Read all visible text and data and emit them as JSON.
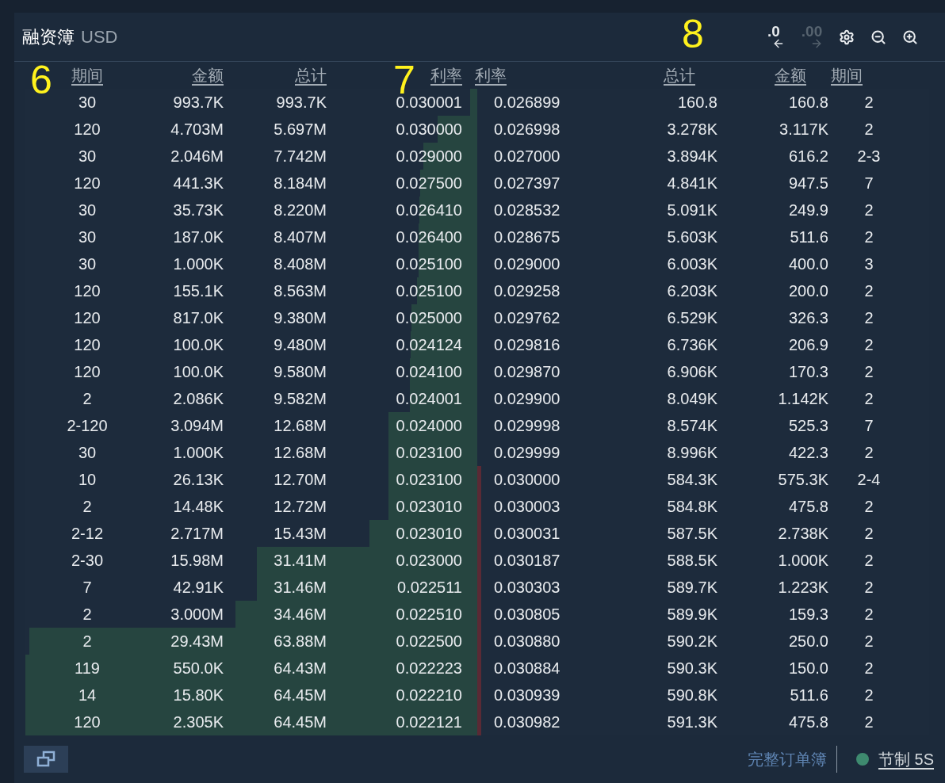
{
  "title": {
    "text": "融资簿",
    "currency": "USD"
  },
  "toolbar": [
    {
      "kind": "precision_down",
      "label": ".0",
      "disabled": false
    },
    {
      "kind": "precision_up",
      "label": ".00",
      "disabled": true
    },
    {
      "kind": "settings"
    },
    {
      "kind": "zoom_out"
    },
    {
      "kind": "zoom_in"
    }
  ],
  "annotations": [
    {
      "label": "6"
    },
    {
      "label": "7"
    },
    {
      "label": "8"
    }
  ],
  "bid_columns": [
    "期间",
    "金额",
    "总计",
    "利率"
  ],
  "ask_columns": [
    "利率",
    "总计",
    "金额",
    "期间"
  ],
  "bids": [
    {
      "period": "30",
      "amount": "993.7K",
      "total": "993.7K",
      "rate": "0.030001",
      "level": 0.015
    },
    {
      "period": "120",
      "amount": "4.703M",
      "total": "5.697M",
      "rate": "0.030000",
      "level": 0.088
    },
    {
      "period": "30",
      "amount": "2.046M",
      "total": "7.742M",
      "rate": "0.029000",
      "level": 0.12
    },
    {
      "period": "120",
      "amount": "441.3K",
      "total": "8.184M",
      "rate": "0.027500",
      "level": 0.127
    },
    {
      "period": "30",
      "amount": "35.73K",
      "total": "8.220M",
      "rate": "0.026410",
      "level": 0.128
    },
    {
      "period": "30",
      "amount": "187.0K",
      "total": "8.407M",
      "rate": "0.026400",
      "level": 0.13
    },
    {
      "period": "30",
      "amount": "1.000K",
      "total": "8.408M",
      "rate": "0.025100",
      "level": 0.13
    },
    {
      "period": "120",
      "amount": "155.1K",
      "total": "8.563M",
      "rate": "0.025100",
      "level": 0.133
    },
    {
      "period": "120",
      "amount": "817.0K",
      "total": "9.380M",
      "rate": "0.025000",
      "level": 0.146
    },
    {
      "period": "120",
      "amount": "100.0K",
      "total": "9.480M",
      "rate": "0.024124",
      "level": 0.147
    },
    {
      "period": "120",
      "amount": "100.0K",
      "total": "9.580M",
      "rate": "0.024100",
      "level": 0.149
    },
    {
      "period": "2",
      "amount": "2.086K",
      "total": "9.582M",
      "rate": "0.024001",
      "level": 0.149
    },
    {
      "period": "2-120",
      "amount": "3.094M",
      "total": "12.68M",
      "rate": "0.024000",
      "level": 0.197
    },
    {
      "period": "30",
      "amount": "1.000K",
      "total": "12.68M",
      "rate": "0.023100",
      "level": 0.197
    },
    {
      "period": "10",
      "amount": "26.13K",
      "total": "12.70M",
      "rate": "0.023100",
      "level": 0.197
    },
    {
      "period": "2",
      "amount": "14.48K",
      "total": "12.72M",
      "rate": "0.023010",
      "level": 0.197
    },
    {
      "period": "2-12",
      "amount": "2.717M",
      "total": "15.43M",
      "rate": "0.023010",
      "level": 0.239
    },
    {
      "period": "2-30",
      "amount": "15.98M",
      "total": "31.41M",
      "rate": "0.023000",
      "level": 0.487
    },
    {
      "period": "7",
      "amount": "42.91K",
      "total": "31.46M",
      "rate": "0.022511",
      "level": 0.488
    },
    {
      "period": "2",
      "amount": "3.000M",
      "total": "34.46M",
      "rate": "0.022510",
      "level": 0.535
    },
    {
      "period": "2",
      "amount": "29.43M",
      "total": "63.88M",
      "rate": "0.022500",
      "level": 0.991
    },
    {
      "period": "119",
      "amount": "550.0K",
      "total": "64.43M",
      "rate": "0.022223",
      "level": 1.0
    },
    {
      "period": "14",
      "amount": "15.80K",
      "total": "64.45M",
      "rate": "0.022210",
      "level": 1.0
    },
    {
      "period": "120",
      "amount": "2.305K",
      "total": "64.45M",
      "rate": "0.022121",
      "level": 1.0
    }
  ],
  "asks": [
    {
      "rate": "0.026899",
      "total": "160.8",
      "amount": "160.8",
      "period": "2"
    },
    {
      "rate": "0.026998",
      "total": "3.278K",
      "amount": "3.117K",
      "period": "2"
    },
    {
      "rate": "0.027000",
      "total": "3.894K",
      "amount": "616.2",
      "period": "2-3"
    },
    {
      "rate": "0.027397",
      "total": "4.841K",
      "amount": "947.5",
      "period": "7"
    },
    {
      "rate": "0.028532",
      "total": "5.091K",
      "amount": "249.9",
      "period": "2"
    },
    {
      "rate": "0.028675",
      "total": "5.603K",
      "amount": "511.6",
      "period": "2"
    },
    {
      "rate": "0.029000",
      "total": "6.003K",
      "amount": "400.0",
      "period": "3"
    },
    {
      "rate": "0.029258",
      "total": "6.203K",
      "amount": "200.0",
      "period": "2"
    },
    {
      "rate": "0.029762",
      "total": "6.529K",
      "amount": "326.3",
      "period": "2"
    },
    {
      "rate": "0.029816",
      "total": "6.736K",
      "amount": "206.9",
      "period": "2"
    },
    {
      "rate": "0.029870",
      "total": "6.906K",
      "amount": "170.3",
      "period": "2"
    },
    {
      "rate": "0.029900",
      "total": "8.049K",
      "amount": "1.142K",
      "period": "2"
    },
    {
      "rate": "0.029998",
      "total": "8.574K",
      "amount": "525.3",
      "period": "7"
    },
    {
      "rate": "0.029999",
      "total": "8.996K",
      "amount": "422.3",
      "period": "2"
    },
    {
      "rate": "0.030000",
      "total": "584.3K",
      "amount": "575.3K",
      "period": "2-4",
      "level": 0.009
    },
    {
      "rate": "0.030003",
      "total": "584.8K",
      "amount": "475.8",
      "period": "2",
      "level": 0.009
    },
    {
      "rate": "0.030031",
      "total": "587.5K",
      "amount": "2.738K",
      "period": "2",
      "level": 0.009
    },
    {
      "rate": "0.030187",
      "total": "588.5K",
      "amount": "1.000K",
      "period": "2",
      "level": 0.009
    },
    {
      "rate": "0.030303",
      "total": "589.7K",
      "amount": "1.223K",
      "period": "2",
      "level": 0.009
    },
    {
      "rate": "0.030805",
      "total": "589.9K",
      "amount": "159.3",
      "period": "2",
      "level": 0.009
    },
    {
      "rate": "0.030880",
      "total": "590.2K",
      "amount": "250.0",
      "period": "2",
      "level": 0.009
    },
    {
      "rate": "0.030884",
      "total": "590.3K",
      "amount": "150.0",
      "period": "2",
      "level": 0.009
    },
    {
      "rate": "0.030939",
      "total": "590.8K",
      "amount": "511.6",
      "period": "2",
      "level": 0.009
    },
    {
      "rate": "0.030982",
      "total": "591.3K",
      "amount": "475.8",
      "period": "2",
      "level": 0.009
    }
  ],
  "footer": {
    "full_book": "完整订单簿",
    "throttle": "节制 5S"
  }
}
